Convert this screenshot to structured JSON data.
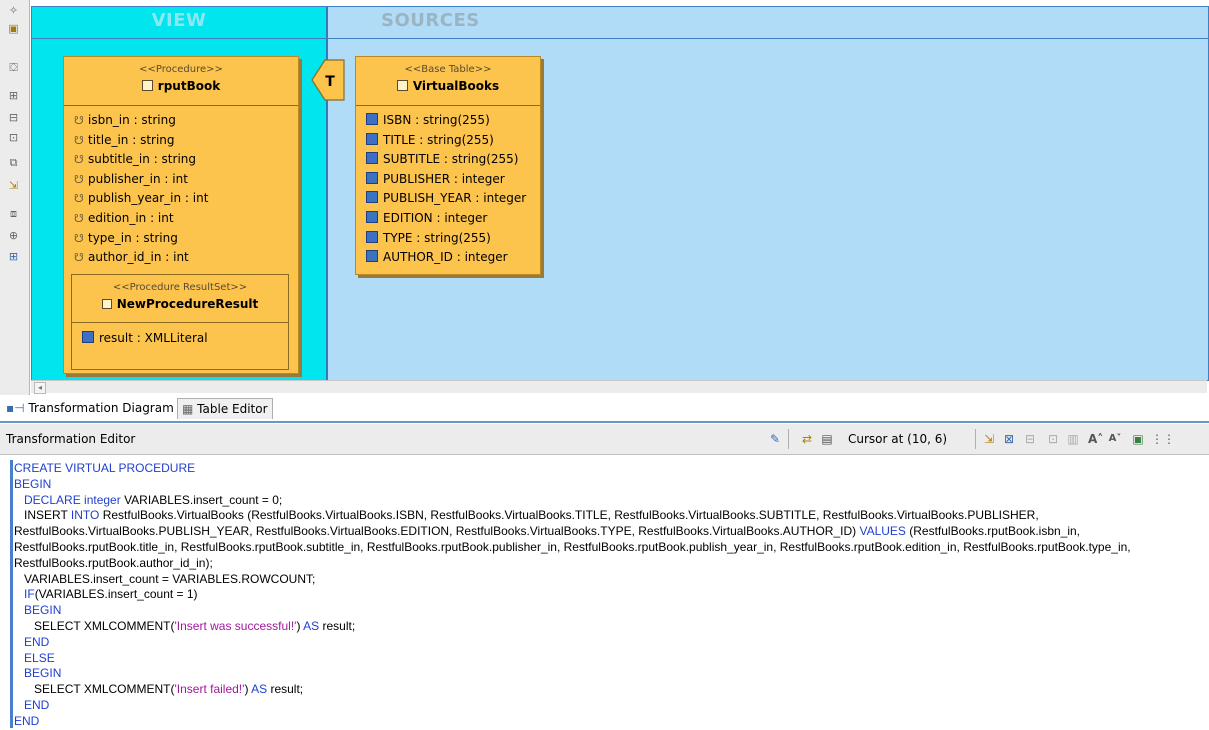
{
  "diagram": {
    "view_title": "VIEW",
    "sources_title": "SOURCES",
    "t_node_label": "T",
    "procedure": {
      "stereotype": "<<Procedure>>",
      "name": "rputBook",
      "params": [
        "isbn_in : string",
        "title_in : string",
        "subtitle_in : string",
        "publisher_in : int",
        "publish_year_in : int",
        "edition_in : int",
        "type_in : string",
        "author_id_in : int"
      ],
      "resultset": {
        "stereotype": "<<Procedure ResultSet>>",
        "name": "NewProcedureResult",
        "columns": [
          "result : XMLLiteral"
        ]
      }
    },
    "table": {
      "stereotype": "<<Base Table>>",
      "name": "VirtualBooks",
      "columns": [
        "ISBN : string(255)",
        "TITLE : string(255)",
        "SUBTITLE : string(255)",
        "PUBLISHER : integer",
        "PUBLISH_YEAR : integer",
        "EDITION : integer",
        "TYPE : string(255)",
        "AUTHOR_ID : integer"
      ]
    }
  },
  "tabs": [
    {
      "label": "Transformation Diagram",
      "icon": "diagram-icon"
    },
    {
      "label": "Table Editor",
      "icon": "table-icon"
    }
  ],
  "editor": {
    "title": "Transformation Editor",
    "cursor": "Cursor at (10, 6)"
  },
  "code": {
    "l1_kw": "CREATE VIRTUAL PROCEDURE",
    "l2_kw": "BEGIN",
    "l3_kw": "DECLARE integer",
    "l3_rest": " VARIABLES.insert_count = 0;",
    "l4_kw": "INSERT INTO",
    "l4_rest": " RestfulBooks.VirtualBooks (RestfulBooks.VirtualBooks.ISBN, RestfulBooks.VirtualBooks.TITLE, RestfulBooks.VirtualBooks.SUBTITLE, RestfulBooks.VirtualBooks.PUBLISHER, RestfulBooks.VirtualBooks.PUBLISH_YEAR, RestfulBooks.VirtualBooks.EDITION, RestfulBooks.VirtualBooks.TYPE, RestfulBooks.VirtualBooks.AUTHOR_ID) ",
    "l4_kw2": "VALUES",
    "l4_rest2": " (RestfulBooks.rputBook.isbn_in, RestfulBooks.rputBook.title_in, RestfulBooks.rputBook.subtitle_in, RestfulBooks.rputBook.publisher_in, RestfulBooks.rputBook.publish_year_in, RestfulBooks.rputBook.edition_in, RestfulBooks.rputBook.type_in, RestfulBooks.rputBook.author_id_in);",
    "l5": "VARIABLES.insert_count = VARIABLES.ROWCOUNT;",
    "l6_kw": "IF",
    "l6_rest": "(VARIABLES.insert_count = 1)",
    "l7_kw": "BEGIN",
    "l8_kw": "SELECT",
    "l8_mid": " XMLCOMMENT(",
    "l8_str": "'Insert was successful!'",
    "l8_mid2": ") ",
    "l8_kw2": "AS",
    "l8_rest": " result;",
    "l9_kw": "END",
    "l10_kw": "ELSE",
    "l11_kw": "BEGIN",
    "l12_kw": "SELECT",
    "l12_mid": " XMLCOMMENT(",
    "l12_str": "'Insert failed!'",
    "l12_mid2": ") ",
    "l12_kw2": "AS",
    "l12_rest": " result;",
    "l13_kw": "END",
    "l14_kw": "END"
  },
  "colors": {
    "view_bg": "#00e5ee",
    "sources_bg": "#b0dcf8",
    "box_fill": "#fcc34d",
    "keyword": "#1f3fd0",
    "string": "#a0199b"
  }
}
